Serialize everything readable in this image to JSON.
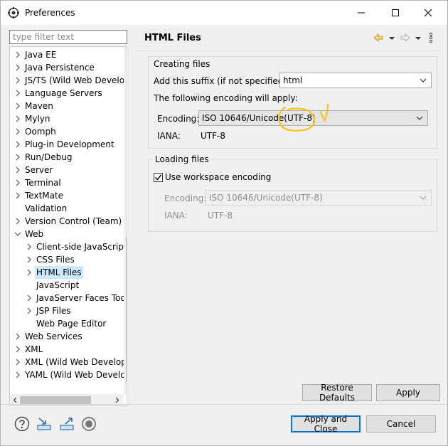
{
  "window": {
    "title": "Preferences",
    "icon": "eclipse-gear-icon"
  },
  "sidebar": {
    "filter_placeholder": "type filter text",
    "items": [
      {
        "label": "Java EE",
        "level": 0,
        "expandable": true
      },
      {
        "label": "Java Persistence",
        "level": 0,
        "expandable": true
      },
      {
        "label": "JS/TS (Wild Web Develo",
        "level": 0,
        "expandable": true
      },
      {
        "label": "Language Servers",
        "level": 0,
        "expandable": true
      },
      {
        "label": "Maven",
        "level": 0,
        "expandable": true
      },
      {
        "label": "Mylyn",
        "level": 0,
        "expandable": true
      },
      {
        "label": "Oomph",
        "level": 0,
        "expandable": true
      },
      {
        "label": "Plug-in Development",
        "level": 0,
        "expandable": true
      },
      {
        "label": "Run/Debug",
        "level": 0,
        "expandable": true
      },
      {
        "label": "Server",
        "level": 0,
        "expandable": true
      },
      {
        "label": "Terminal",
        "level": 0,
        "expandable": true
      },
      {
        "label": "TextMate",
        "level": 0,
        "expandable": true
      },
      {
        "label": "Validation",
        "level": 0,
        "expandable": false
      },
      {
        "label": "Version Control (Team)",
        "level": 0,
        "expandable": true
      },
      {
        "label": "Web",
        "level": 0,
        "expandable": true,
        "expanded": true
      },
      {
        "label": "Client-side JavaScript",
        "level": 1,
        "expandable": true
      },
      {
        "label": "CSS Files",
        "level": 1,
        "expandable": true
      },
      {
        "label": "HTML Files",
        "level": 1,
        "expandable": true,
        "selected": true
      },
      {
        "label": "JavaScript",
        "level": 1,
        "expandable": false
      },
      {
        "label": "JavaServer Faces Tool",
        "level": 1,
        "expandable": true
      },
      {
        "label": "JSP Files",
        "level": 1,
        "expandable": true
      },
      {
        "label": "Web Page Editor",
        "level": 1,
        "expandable": false
      },
      {
        "label": "Web Services",
        "level": 0,
        "expandable": true
      },
      {
        "label": "XML",
        "level": 0,
        "expandable": true
      },
      {
        "label": "XML (Wild Web Develop",
        "level": 0,
        "expandable": true
      },
      {
        "label": "YAML (Wild Web Develo",
        "level": 0,
        "expandable": true
      }
    ]
  },
  "page": {
    "title": "HTML Files",
    "creating": {
      "group_title": "Creating files",
      "suffix_label": "Add this suffix (if not specified):",
      "suffix_value": "html",
      "encoding_note": "The following encoding will apply:",
      "encoding_label": "Encoding:",
      "encoding_value": "ISO 10646/Unicode(UTF-8)",
      "iana_label": "IANA:",
      "iana_value": "UTF-8"
    },
    "loading": {
      "group_title": "Loading files",
      "workspace_checkbox_label": "Use workspace encoding",
      "workspace_checked": true,
      "encoding_label": "Encoding:",
      "encoding_value": "ISO 10646/Unicode(UTF-8)",
      "iana_label": "IANA:",
      "iana_value": "UTF-8"
    }
  },
  "buttons": {
    "restore_defaults": "Restore Defaults",
    "apply": "Apply",
    "apply_and_close": "Apply and Close",
    "cancel": "Cancel"
  },
  "colors": {
    "selection": "#cce8ff",
    "default_button_border": "#0078d7",
    "annotation": "#f5c518"
  }
}
